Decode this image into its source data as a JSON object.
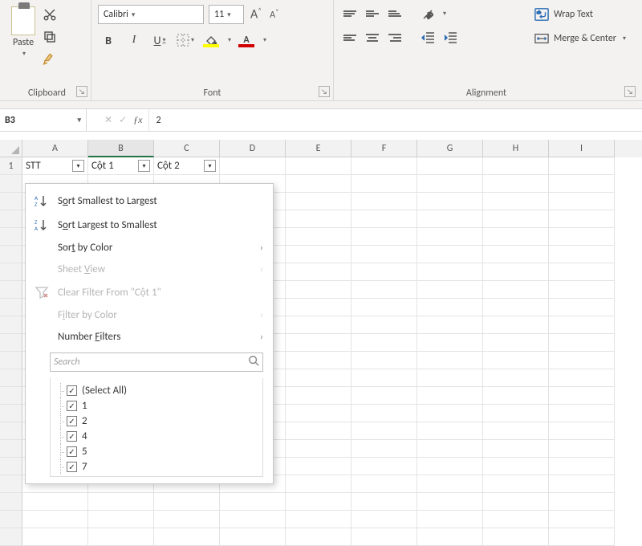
{
  "ribbon": {
    "clipboard": {
      "label": "Clipboard",
      "paste": "Paste"
    },
    "font": {
      "label": "Font",
      "name": "Calibri",
      "size": "11",
      "bold": "B",
      "italic": "I",
      "underline": "U",
      "fontcolor_letter": "A",
      "fill_letter": "A",
      "increase": "A",
      "decrease": "A"
    },
    "alignment": {
      "label": "Alignment",
      "wrap": "Wrap Text",
      "merge": "Merge & Center"
    }
  },
  "name_box": "B3",
  "formula_value": "2",
  "columns": [
    "A",
    "B",
    "C",
    "D",
    "E",
    "F",
    "G",
    "H",
    "I"
  ],
  "active_col": "B",
  "row1_headers": [
    "STT",
    "Cột 1",
    "Cột 2"
  ],
  "filter_menu": {
    "sort_asc": "Sort Smallest to Largest",
    "sort_desc": "Sort Largest to Smallest",
    "sort_color": "Sort by Color",
    "sheet_view": "Sheet View",
    "clear_filter": "Clear Filter From \"Cột 1\"",
    "filter_color": "Filter by Color",
    "number_filters": "Number Filters",
    "search_placeholder": "Search",
    "items": [
      "(Select All)",
      "1",
      "2",
      "4",
      "5",
      "7"
    ]
  }
}
